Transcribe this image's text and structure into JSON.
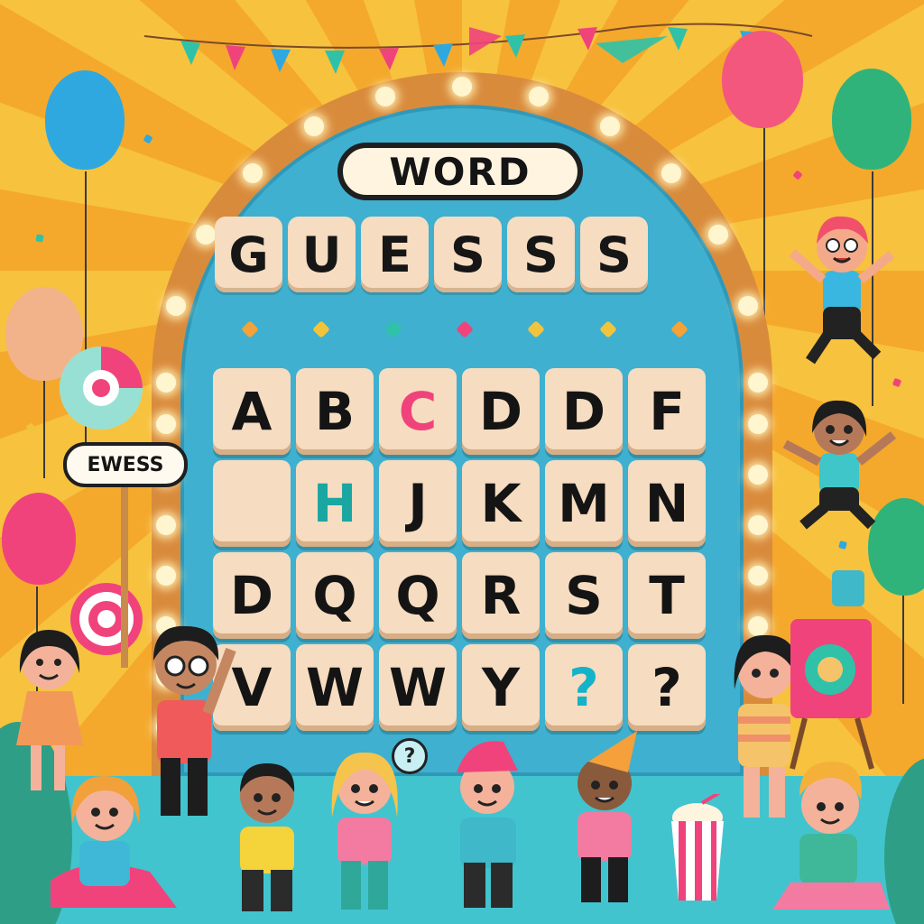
{
  "title_badge": "WORD",
  "title_tiles": [
    "G",
    "U",
    "E",
    "S",
    "S",
    "S"
  ],
  "side_sign": "EWESS",
  "letter_grid": [
    [
      {
        "ch": "A",
        "color": "#141414"
      },
      {
        "ch": "B",
        "color": "#141414"
      },
      {
        "ch": "C",
        "color": "#f0437c"
      },
      {
        "ch": "D",
        "color": "#141414"
      },
      {
        "ch": "D",
        "color": "#141414"
      },
      {
        "ch": "F",
        "color": "#141414"
      }
    ],
    [
      {
        "ch": "",
        "color": "#141414"
      },
      {
        "ch": "H",
        "color": "#1aa6a1"
      },
      {
        "ch": "J",
        "color": "#141414"
      },
      {
        "ch": "K",
        "color": "#141414"
      },
      {
        "ch": "M",
        "color": "#141414"
      },
      {
        "ch": "N",
        "color": "#141414"
      }
    ],
    [
      {
        "ch": "D",
        "color": "#141414"
      },
      {
        "ch": "Q",
        "color": "#141414"
      },
      {
        "ch": "Q",
        "color": "#141414"
      },
      {
        "ch": "R",
        "color": "#141414"
      },
      {
        "ch": "S",
        "color": "#141414"
      },
      {
        "ch": "T",
        "color": "#141414"
      }
    ],
    [
      {
        "ch": "V",
        "color": "#141414"
      },
      {
        "ch": "W",
        "color": "#141414"
      },
      {
        "ch": "W",
        "color": "#141414"
      },
      {
        "ch": "Y",
        "color": "#141414"
      },
      {
        "ch": "?",
        "color": "#14b3c9"
      },
      {
        "ch": "?",
        "color": "#141414"
      }
    ]
  ],
  "bubble": "?",
  "colors": {
    "sky_light": "#f7c23e",
    "sky_dark": "#f4a92c",
    "arch": "#d98b3c",
    "board": "#3fb0cf",
    "tile": "#f6dcc0",
    "floor": "#42c4cf"
  },
  "decor_dots": [
    "#f4a23a",
    "#f2c43b",
    "#2fc2a8",
    "#f0437c",
    "#f2c43b",
    "#f2c43b",
    "#f4a23a"
  ]
}
